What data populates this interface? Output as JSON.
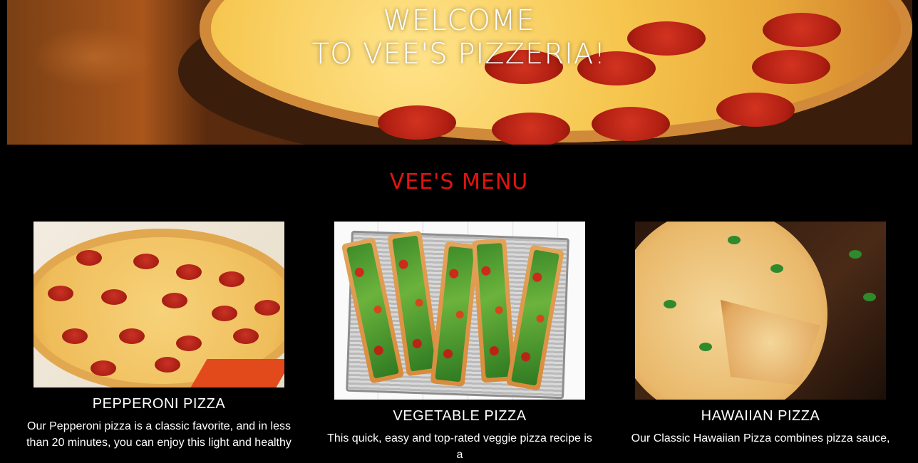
{
  "hero": {
    "title_line1": "Welcome",
    "title_line2": "to Vee's Pizzeria!"
  },
  "menu": {
    "title": "Vee's Menu",
    "items": [
      {
        "name": "PEPPERONI PIZZA",
        "description": "Our Pepperoni pizza is a classic favorite, and in less than 20 minutes, you can enjoy this light and healthy"
      },
      {
        "name": "VEGETABLE PIZZA",
        "description": "This quick, easy and top-rated veggie pizza recipe is a"
      },
      {
        "name": "HAWAIIAN PIZZA",
        "description": "Our Classic Hawaiian Pizza combines pizza sauce,"
      }
    ]
  },
  "colors": {
    "background": "#000000",
    "menu_title": "#e0140f",
    "text": "#ffffff"
  }
}
